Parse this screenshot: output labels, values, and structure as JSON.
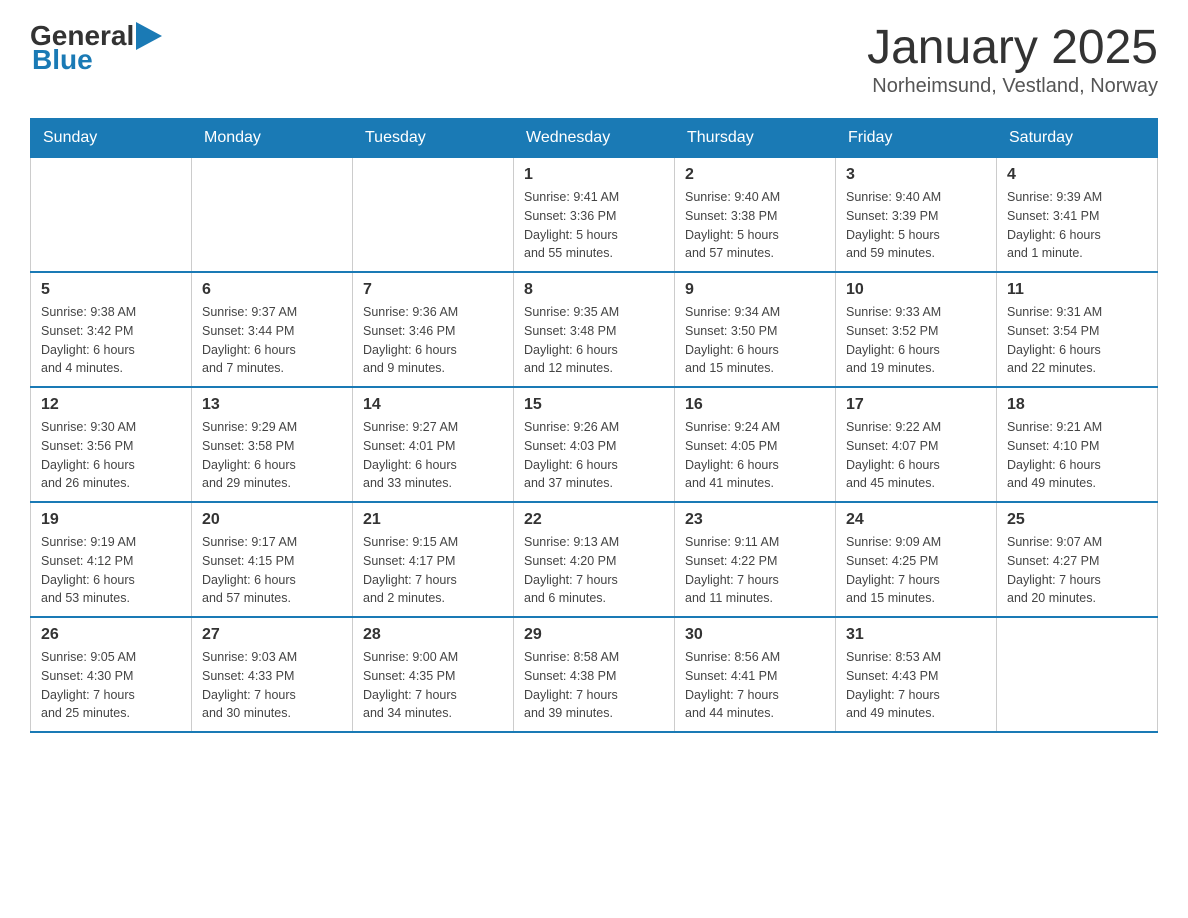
{
  "logo": {
    "text_general": "General",
    "text_blue": "Blue"
  },
  "title": "January 2025",
  "subtitle": "Norheimsund, Vestland, Norway",
  "days_of_week": [
    "Sunday",
    "Monday",
    "Tuesday",
    "Wednesday",
    "Thursday",
    "Friday",
    "Saturday"
  ],
  "weeks": [
    [
      {
        "day": "",
        "info": ""
      },
      {
        "day": "",
        "info": ""
      },
      {
        "day": "",
        "info": ""
      },
      {
        "day": "1",
        "info": "Sunrise: 9:41 AM\nSunset: 3:36 PM\nDaylight: 5 hours\nand 55 minutes."
      },
      {
        "day": "2",
        "info": "Sunrise: 9:40 AM\nSunset: 3:38 PM\nDaylight: 5 hours\nand 57 minutes."
      },
      {
        "day": "3",
        "info": "Sunrise: 9:40 AM\nSunset: 3:39 PM\nDaylight: 5 hours\nand 59 minutes."
      },
      {
        "day": "4",
        "info": "Sunrise: 9:39 AM\nSunset: 3:41 PM\nDaylight: 6 hours\nand 1 minute."
      }
    ],
    [
      {
        "day": "5",
        "info": "Sunrise: 9:38 AM\nSunset: 3:42 PM\nDaylight: 6 hours\nand 4 minutes."
      },
      {
        "day": "6",
        "info": "Sunrise: 9:37 AM\nSunset: 3:44 PM\nDaylight: 6 hours\nand 7 minutes."
      },
      {
        "day": "7",
        "info": "Sunrise: 9:36 AM\nSunset: 3:46 PM\nDaylight: 6 hours\nand 9 minutes."
      },
      {
        "day": "8",
        "info": "Sunrise: 9:35 AM\nSunset: 3:48 PM\nDaylight: 6 hours\nand 12 minutes."
      },
      {
        "day": "9",
        "info": "Sunrise: 9:34 AM\nSunset: 3:50 PM\nDaylight: 6 hours\nand 15 minutes."
      },
      {
        "day": "10",
        "info": "Sunrise: 9:33 AM\nSunset: 3:52 PM\nDaylight: 6 hours\nand 19 minutes."
      },
      {
        "day": "11",
        "info": "Sunrise: 9:31 AM\nSunset: 3:54 PM\nDaylight: 6 hours\nand 22 minutes."
      }
    ],
    [
      {
        "day": "12",
        "info": "Sunrise: 9:30 AM\nSunset: 3:56 PM\nDaylight: 6 hours\nand 26 minutes."
      },
      {
        "day": "13",
        "info": "Sunrise: 9:29 AM\nSunset: 3:58 PM\nDaylight: 6 hours\nand 29 minutes."
      },
      {
        "day": "14",
        "info": "Sunrise: 9:27 AM\nSunset: 4:01 PM\nDaylight: 6 hours\nand 33 minutes."
      },
      {
        "day": "15",
        "info": "Sunrise: 9:26 AM\nSunset: 4:03 PM\nDaylight: 6 hours\nand 37 minutes."
      },
      {
        "day": "16",
        "info": "Sunrise: 9:24 AM\nSunset: 4:05 PM\nDaylight: 6 hours\nand 41 minutes."
      },
      {
        "day": "17",
        "info": "Sunrise: 9:22 AM\nSunset: 4:07 PM\nDaylight: 6 hours\nand 45 minutes."
      },
      {
        "day": "18",
        "info": "Sunrise: 9:21 AM\nSunset: 4:10 PM\nDaylight: 6 hours\nand 49 minutes."
      }
    ],
    [
      {
        "day": "19",
        "info": "Sunrise: 9:19 AM\nSunset: 4:12 PM\nDaylight: 6 hours\nand 53 minutes."
      },
      {
        "day": "20",
        "info": "Sunrise: 9:17 AM\nSunset: 4:15 PM\nDaylight: 6 hours\nand 57 minutes."
      },
      {
        "day": "21",
        "info": "Sunrise: 9:15 AM\nSunset: 4:17 PM\nDaylight: 7 hours\nand 2 minutes."
      },
      {
        "day": "22",
        "info": "Sunrise: 9:13 AM\nSunset: 4:20 PM\nDaylight: 7 hours\nand 6 minutes."
      },
      {
        "day": "23",
        "info": "Sunrise: 9:11 AM\nSunset: 4:22 PM\nDaylight: 7 hours\nand 11 minutes."
      },
      {
        "day": "24",
        "info": "Sunrise: 9:09 AM\nSunset: 4:25 PM\nDaylight: 7 hours\nand 15 minutes."
      },
      {
        "day": "25",
        "info": "Sunrise: 9:07 AM\nSunset: 4:27 PM\nDaylight: 7 hours\nand 20 minutes."
      }
    ],
    [
      {
        "day": "26",
        "info": "Sunrise: 9:05 AM\nSunset: 4:30 PM\nDaylight: 7 hours\nand 25 minutes."
      },
      {
        "day": "27",
        "info": "Sunrise: 9:03 AM\nSunset: 4:33 PM\nDaylight: 7 hours\nand 30 minutes."
      },
      {
        "day": "28",
        "info": "Sunrise: 9:00 AM\nSunset: 4:35 PM\nDaylight: 7 hours\nand 34 minutes."
      },
      {
        "day": "29",
        "info": "Sunrise: 8:58 AM\nSunset: 4:38 PM\nDaylight: 7 hours\nand 39 minutes."
      },
      {
        "day": "30",
        "info": "Sunrise: 8:56 AM\nSunset: 4:41 PM\nDaylight: 7 hours\nand 44 minutes."
      },
      {
        "day": "31",
        "info": "Sunrise: 8:53 AM\nSunset: 4:43 PM\nDaylight: 7 hours\nand 49 minutes."
      },
      {
        "day": "",
        "info": ""
      }
    ]
  ]
}
